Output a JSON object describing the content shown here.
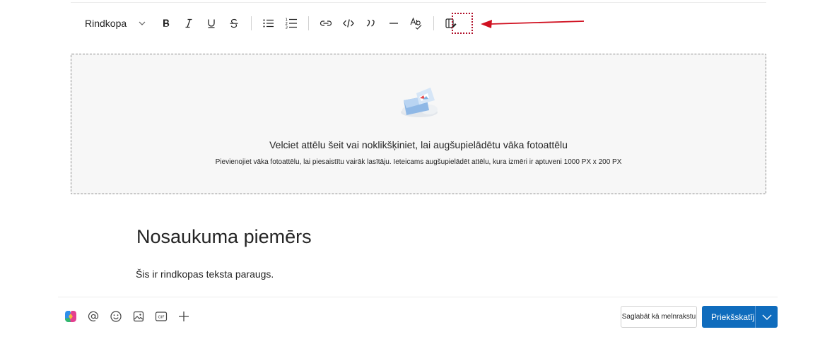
{
  "toolbar": {
    "style_select": "Rindkopa",
    "icons": [
      "bold-icon",
      "italic-icon",
      "underline-icon",
      "strikethrough-icon",
      "bulleted-list-icon",
      "numbered-list-icon",
      "link-icon",
      "code-icon",
      "quote-icon",
      "divider-icon",
      "spellcheck-icon",
      "cover-edit-icon"
    ],
    "accent_color": "#c50f1f"
  },
  "upload": {
    "title": "Velciet attēlu šeit vai noklikšķiniet, lai augšupielādētu vāka fotoattēlu",
    "subtitle": "Pievienojiet vāka fotoattēlu, lai piesaistītu vairāk lasītāju. Ieteicams augšupielādēt attēlu, kura izmēri ir aptuveni 1000 PX x 200 PX"
  },
  "content": {
    "heading": "Nosaukuma piemērs",
    "paragraph": "Šis ir rindkopas teksta paraugs."
  },
  "bottom": {
    "icons": [
      "copilot-icon",
      "mention-icon",
      "emoji-icon",
      "image-icon",
      "gif-icon",
      "add-icon"
    ],
    "gif_label": "GIF",
    "save_draft": "Saglabāt kā melnrakstu",
    "preview": "Priekšskatījums",
    "primary_color": "#0f6cbd"
  }
}
